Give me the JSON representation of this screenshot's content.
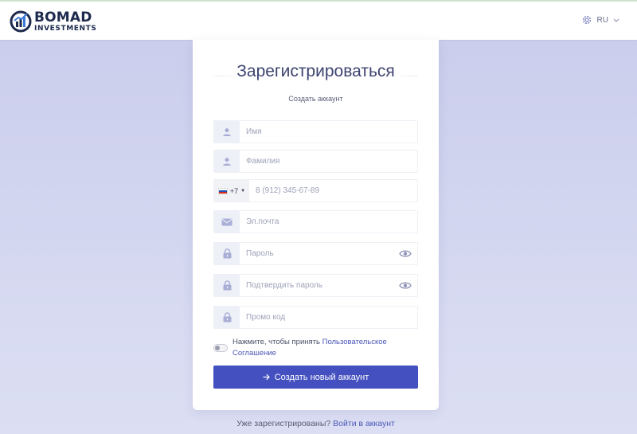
{
  "header": {
    "brand_name": "BOMAD",
    "brand_sub": "INVESTMENTS",
    "language": "RU"
  },
  "form": {
    "title": "Зарегистрироваться",
    "subtitle": "Создать аккаунт",
    "first_name": {
      "placeholder": "Имя",
      "value": ""
    },
    "last_name": {
      "placeholder": "Фамилия",
      "value": ""
    },
    "phone": {
      "country_code": "+7",
      "placeholder": "8 (912) 345-67-89",
      "value": ""
    },
    "email": {
      "placeholder": "Эл.почта",
      "value": ""
    },
    "password": {
      "placeholder": "Пароль",
      "value": ""
    },
    "confirm_password": {
      "placeholder": "Подтвердить пароль",
      "value": ""
    },
    "promo_code": {
      "placeholder": "Промо код",
      "value": ""
    },
    "agree_prefix": "Нажмите, чтобы принять",
    "agree_link": "Пользовательское Соглашение",
    "submit_label": "Создать новый аккаунт"
  },
  "footer": {
    "prompt": "Уже зарегистрированы?",
    "login_link": "Войти в аккаунт"
  },
  "colors": {
    "accent": "#4450c0",
    "link": "#4a56b8",
    "title": "#3d4470",
    "addon_bg": "#eef0f8",
    "icon": "#a9aed6"
  },
  "icons": {
    "language": "gear-icon",
    "first_name": "user-icon",
    "last_name": "user-icon",
    "email": "mail-icon",
    "password": "lock-icon",
    "confirm_password": "lock-icon",
    "promo_code": "lock-icon",
    "show_password": "eye-icon",
    "submit": "arrow-right-icon"
  }
}
